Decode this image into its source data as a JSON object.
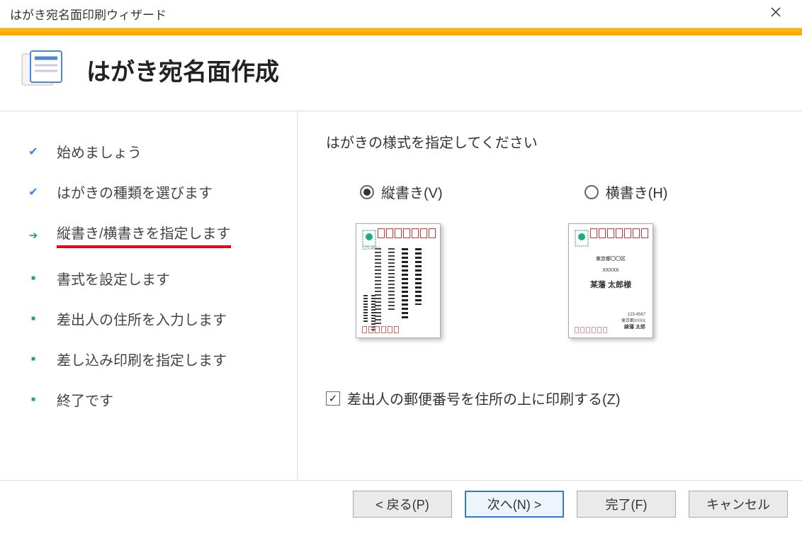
{
  "window": {
    "title": "はがき宛名面印刷ウィザード"
  },
  "banner": {
    "title": "はがき宛名面作成"
  },
  "steps": [
    {
      "label": "始めましょう",
      "state": "done"
    },
    {
      "label": "はがきの種類を選びます",
      "state": "done"
    },
    {
      "label": "縦書き/横書きを指定します",
      "state": "current"
    },
    {
      "label": "書式を設定します",
      "state": "pending"
    },
    {
      "label": "差出人の住所を入力します",
      "state": "pending"
    },
    {
      "label": "差し込み印刷を指定します",
      "state": "pending"
    },
    {
      "label": "終了です",
      "state": "pending"
    }
  ],
  "right": {
    "prompt": "はがきの様式を指定してください",
    "radio_vertical": "縦書き(V)",
    "radio_horizontal": "横書き(H)",
    "checkbox_label": "差出人の郵便番号を住所の上に印刷する(Z)"
  },
  "footer": {
    "back": "< 戻る(P)",
    "next": "次へ(N) >",
    "finish": "完了(F)",
    "cancel": "キャンセル"
  }
}
